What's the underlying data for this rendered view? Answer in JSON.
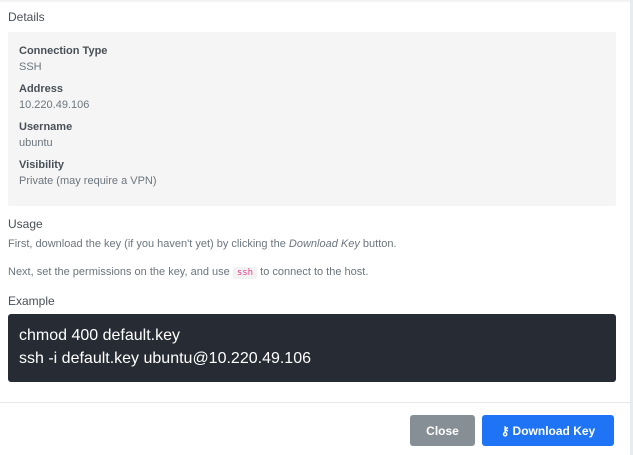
{
  "details": {
    "title": "Details",
    "fields": [
      {
        "label": "Connection Type",
        "value": "SSH"
      },
      {
        "label": "Address",
        "value": "10.220.49.106"
      },
      {
        "label": "Username",
        "value": "ubuntu"
      },
      {
        "label": "Visibility",
        "value": "Private (may require a VPN)"
      }
    ]
  },
  "usage": {
    "title": "Usage",
    "line1_pre": "First, download the key (if you haven't yet) by clicking the ",
    "line1_em": "Download Key",
    "line1_post": " button.",
    "line2_pre": "Next, set the permissions on the key, and use ",
    "line2_code": "ssh",
    "line2_post": " to connect to the host."
  },
  "example": {
    "title": "Example",
    "lines": [
      "chmod 400 default.key",
      "ssh -i default.key ubuntu@10.220.49.106"
    ]
  },
  "footer": {
    "close_label": "Close",
    "download_label": "Download Key",
    "download_icon": "key-icon"
  },
  "colors": {
    "primary": "#1e74f5",
    "secondary": "#868e96",
    "code_bg": "#272b33"
  }
}
